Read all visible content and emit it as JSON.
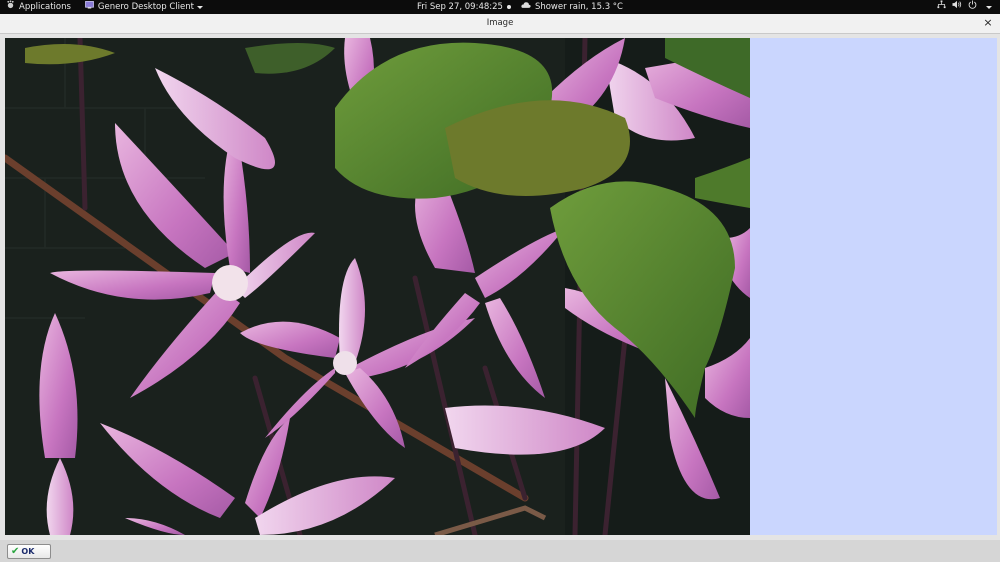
{
  "topbar": {
    "applications_label": "Applications",
    "app_name": "Genero Desktop Client",
    "datetime": "Fri Sep 27, 09:48:25",
    "weather": "Shower rain, 15.3 °C"
  },
  "window": {
    "title": "Image",
    "close_glyph": "×"
  },
  "footer": {
    "ok_label": "OK"
  },
  "colors": {
    "topbar_bg": "#0c0c0c",
    "side_panel": "#cad6fe",
    "ok_check": "#2aa540"
  }
}
